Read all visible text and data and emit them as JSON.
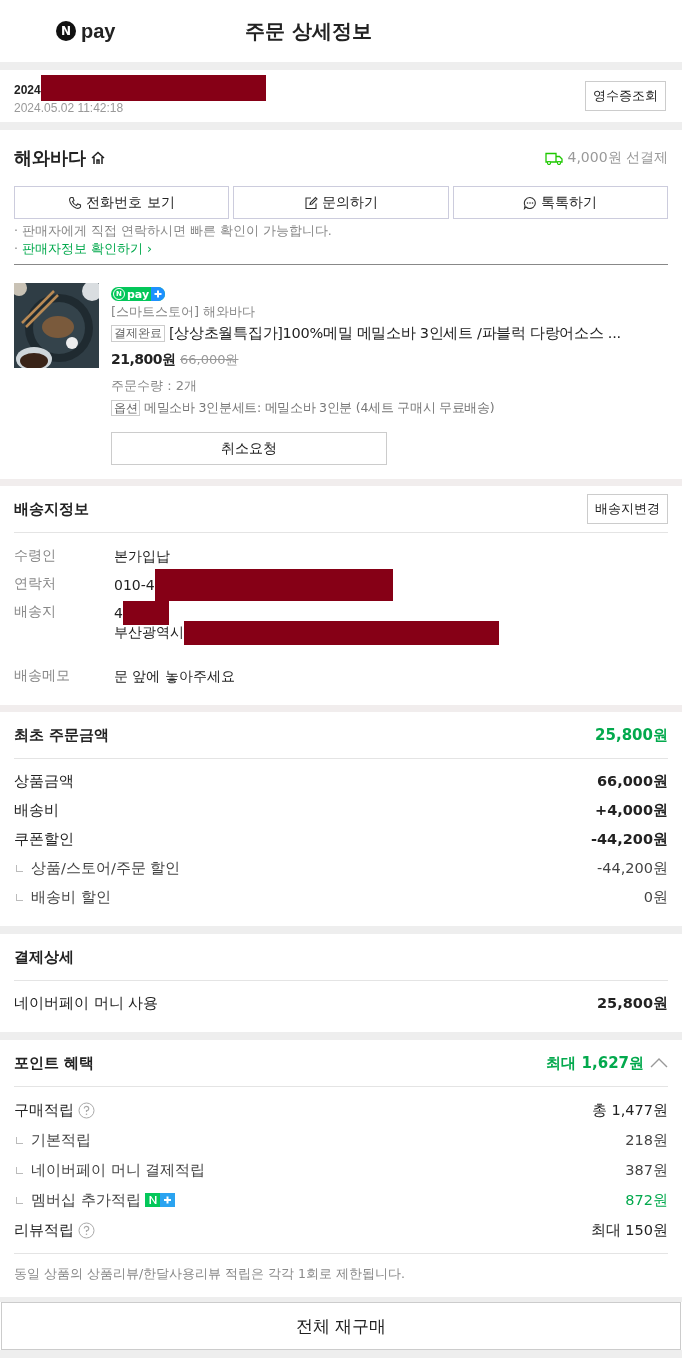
{
  "header": {
    "logo_letter": "N",
    "logo_text": "pay",
    "title": "주문 상세정보"
  },
  "order": {
    "number_prefix": "2024",
    "datetime": "2024.05.02 11:42:18",
    "receipt_button": "영수증조회"
  },
  "seller": {
    "name": "해와바다",
    "shipping": "4,000원 선결제",
    "buttons": [
      {
        "kind": "phone",
        "label": "전화번호 보기"
      },
      {
        "kind": "edit",
        "label": "문의하기"
      },
      {
        "kind": "chat",
        "label": "톡톡하기"
      }
    ],
    "notice": "· 판매자에게 직접 연락하시면 빠른 확인이 가능합니다.",
    "bullet": "·",
    "info_link": "판매자정보 확인하기 ›"
  },
  "product": {
    "badge_letter": "N",
    "badge_text": "pay",
    "store": "[스마트스토어] 해와바다",
    "status": "결제완료",
    "name": "[상상초월특집가]100%메밀 메밀소바 3인세트 /파블럭 다랑어소스 ...",
    "price": "21,800원",
    "original_price": "66,000원",
    "quantity": "주문수량 : 2개",
    "option_tag": "옵션",
    "option": "메밀소바 3인분세트: 메밀소바 3인분 (4세트 구매시 무료배송)",
    "cancel_button": "취소요청"
  },
  "delivery": {
    "title": "배송지정보",
    "change_button": "배송지변경",
    "rows": [
      {
        "label": "수령인",
        "lines": [
          "본가입납"
        ],
        "redacted": false
      },
      {
        "label": "연락처",
        "lines": [
          "010-4"
        ],
        "redacted": true
      },
      {
        "label": "배송지",
        "lines": [
          "4",
          "부산광역시"
        ],
        "redacted": true
      },
      {
        "label": "배송메모",
        "lines": [
          "문 앞에 놓아주세요"
        ],
        "redacted": false
      }
    ]
  },
  "amounts": {
    "title": "최초 주문금액",
    "total": "25,800원",
    "rows": [
      {
        "kind": "main",
        "label": "상품금액",
        "value": "66,000원"
      },
      {
        "kind": "main",
        "label": "배송비",
        "value": "+4,000원"
      },
      {
        "kind": "main",
        "label": "쿠폰할인",
        "value": "-44,200원"
      },
      {
        "kind": "sub",
        "label": "상품/스토어/주문 할인",
        "value": "-44,200원"
      },
      {
        "kind": "sub",
        "label": "배송비 할인",
        "value": "0원"
      }
    ]
  },
  "payment": {
    "title": "결제상세",
    "rows": [
      {
        "label": "네이버페이 머니 사용",
        "value": "25,800원"
      }
    ]
  },
  "points": {
    "title": "포인트 혜택",
    "total": "최대 1,627원",
    "expanded": true,
    "rows": [
      {
        "kind": "main",
        "label": "구매적립",
        "value": "총 1,477원",
        "help": true,
        "badge": false,
        "accent": false
      },
      {
        "kind": "sub",
        "label": "기본적립",
        "value": "218원",
        "help": false,
        "badge": false,
        "accent": false
      },
      {
        "kind": "sub",
        "label": "네이버페이 머니 결제적립",
        "value": "387원",
        "help": false,
        "badge": false,
        "accent": false
      },
      {
        "kind": "sub",
        "label": "멤버십 추가적립",
        "value": "872원",
        "help": false,
        "badge": true,
        "accent": true
      },
      {
        "kind": "main",
        "label": "리뷰적립",
        "value": "최대 150원",
        "help": true,
        "badge": false,
        "accent": false
      }
    ],
    "note": "동일 상품의 상품리뷰/한달사용리뷰 적립은 각각 1회로 제한됩니다."
  },
  "reorder_button": "전체 재구매"
}
